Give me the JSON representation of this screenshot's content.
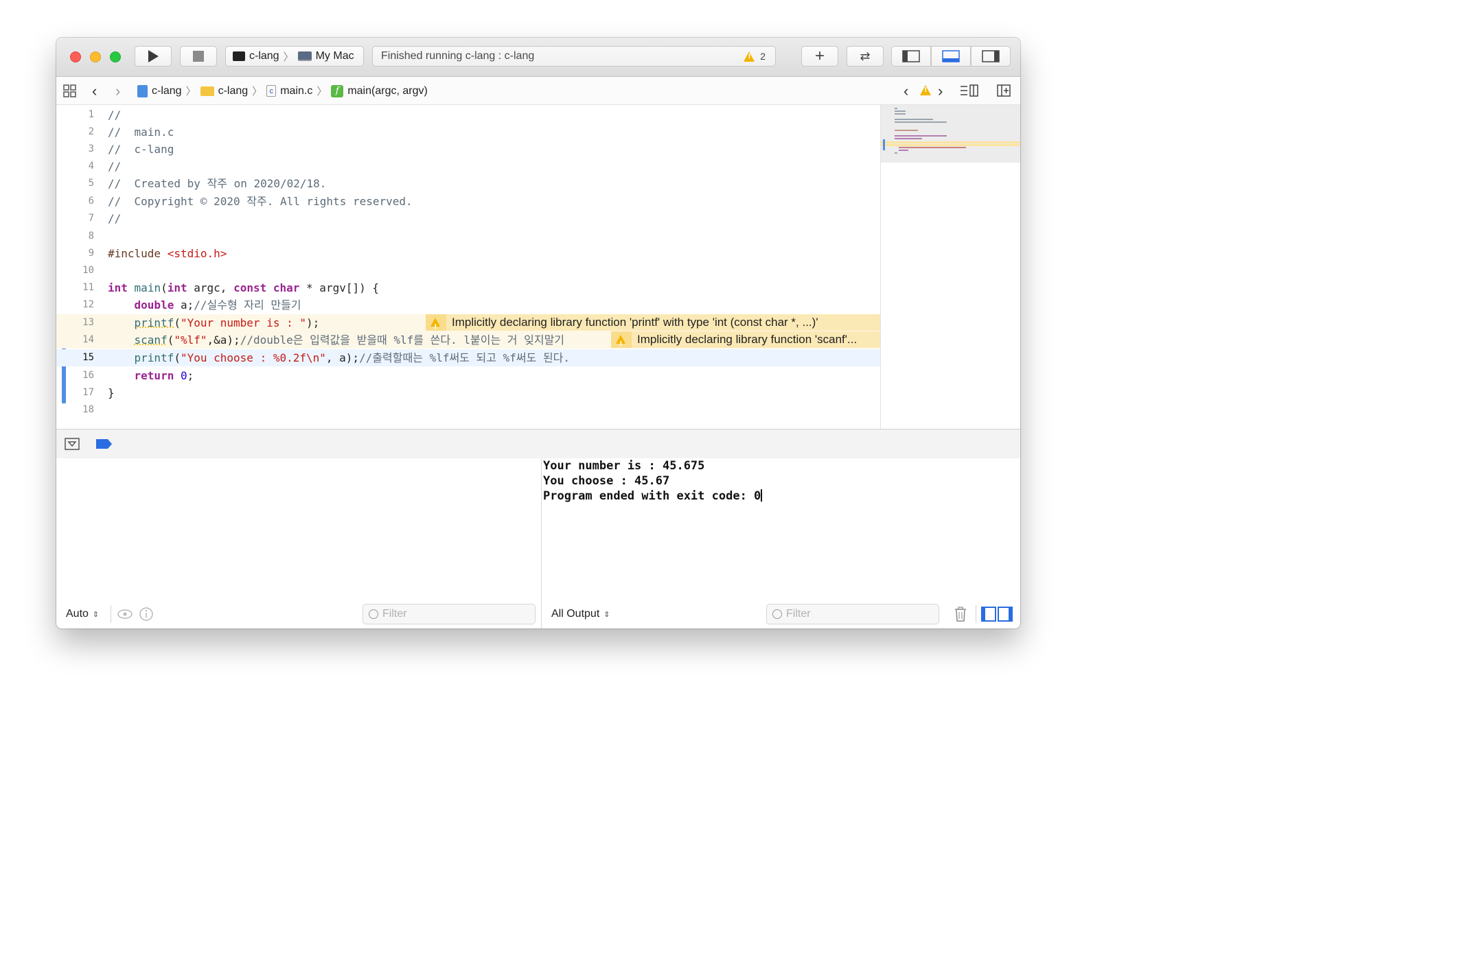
{
  "toolbar": {
    "scheme": "c-lang",
    "destination": "My Mac",
    "activity": "Finished running c-lang : c-lang",
    "warning_count": "2",
    "add_label": "+",
    "swap_label": "⇄"
  },
  "jumpbar": {
    "crumbs": [
      "c-lang",
      "c-lang",
      "main.c",
      "main(argc, argv)"
    ],
    "file_icon_letter": "c",
    "func_icon_letter": "f"
  },
  "editor": {
    "lines": [
      "1",
      "2",
      "3",
      "4",
      "5",
      "6",
      "7",
      "8",
      "9",
      "10",
      "11",
      "12",
      "13",
      "14",
      "15",
      "16",
      "17",
      "18"
    ],
    "current_line": "15",
    "code": {
      "l1": "//",
      "l2": "//  main.c",
      "l3": "//  c-lang",
      "l4": "//",
      "l5": "//  Created by 작주 on 2020/02/18.",
      "l6": "//  Copyright © 2020 작주. All rights reserved.",
      "l7": "//",
      "l9_pp": "#include ",
      "l9_str": "<stdio.h>",
      "l11": {
        "kw1": "int",
        "fn": "main",
        "p1": "(",
        "kw2": "int",
        "p2": " argc, ",
        "kw3": "const",
        "sp": " ",
        "kw4": "char",
        "p3": " * argv[]) {"
      },
      "l12": {
        "indent": "    ",
        "kw": "double",
        "rest": " a;",
        "cm": "//실수형 자리 만들기"
      },
      "l13": {
        "indent": "    ",
        "fn": "printf",
        "p1": "(",
        "str": "\"Your number is : \"",
        "p2": ");"
      },
      "l14": {
        "indent": "    ",
        "fn": "scanf",
        "p1": "(",
        "str": "\"%lf\"",
        "p2": ",&a);",
        "cm": "//double은 입력값을 받을때 %lf를 쓴다. l붙이는 거 잊지말기"
      },
      "l15": {
        "indent": "    ",
        "fn": "printf",
        "p1": "(",
        "str": "\"You choose : %0.2f\\n\"",
        "p2": ", a);",
        "cm": "//출력할때는 %lf써도 되고 %f써도 된다."
      },
      "l16": {
        "indent": "    ",
        "kw": "return",
        "sp": " ",
        "num": "0",
        "p": ";"
      },
      "l17": "}"
    },
    "issues": [
      "Implicitly declaring library function 'printf' with type 'int (const char *, ...)'",
      "Implicitly declaring library function 'scanf'..."
    ]
  },
  "console": {
    "output": [
      "Your number is : 45.675",
      "You choose : 45.67",
      "Program ended with exit code: 0"
    ]
  },
  "footer": {
    "variables_mode": "Auto",
    "output_mode": "All Output",
    "filter_placeholder": "Filter",
    "stepper": "⌃⌄"
  },
  "colors": {
    "keyword": "#9b2393",
    "string": "#c41a16",
    "number": "#1c00cf",
    "comment": "#5d6c79",
    "accent": "#3478f6",
    "warning": "#f4b400"
  }
}
